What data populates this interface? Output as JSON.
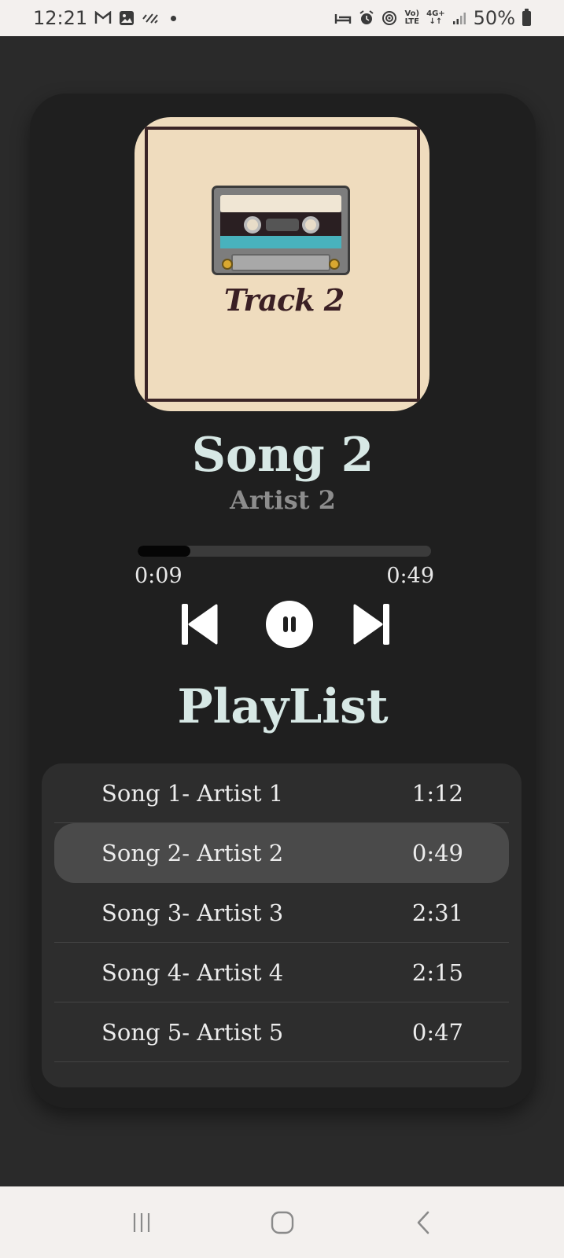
{
  "status_bar": {
    "time": "12:21",
    "net_top": "Vo)",
    "net_bottom": "LTE",
    "gen_top": "4G+",
    "gen_bottom": "↓↑",
    "battery": "50%"
  },
  "player": {
    "cover_text": "Track 2",
    "title": "Song 2",
    "artist": "Artist 2",
    "progress": 0.18,
    "time_current": "0:09",
    "time_total": "0:49",
    "is_playing": true
  },
  "playlist": {
    "heading": "PlayList",
    "items": [
      {
        "label": "Song 1- Artist 1",
        "duration": "1:12",
        "active": false
      },
      {
        "label": "Song 2- Artist 2",
        "duration": "0:49",
        "active": true
      },
      {
        "label": "Song 3- Artist 3",
        "duration": "2:31",
        "active": false
      },
      {
        "label": "Song 4- Artist 4",
        "duration": "2:15",
        "active": false
      },
      {
        "label": "Song 5- Artist 5",
        "duration": "0:47",
        "active": false
      }
    ]
  },
  "colors": {
    "background": "#2a2a2a",
    "card": "#1f1f1f",
    "title_text": "#d7e8e5",
    "playlist_bg": "#2d2d2d",
    "active_row": "#4a4a4a"
  }
}
